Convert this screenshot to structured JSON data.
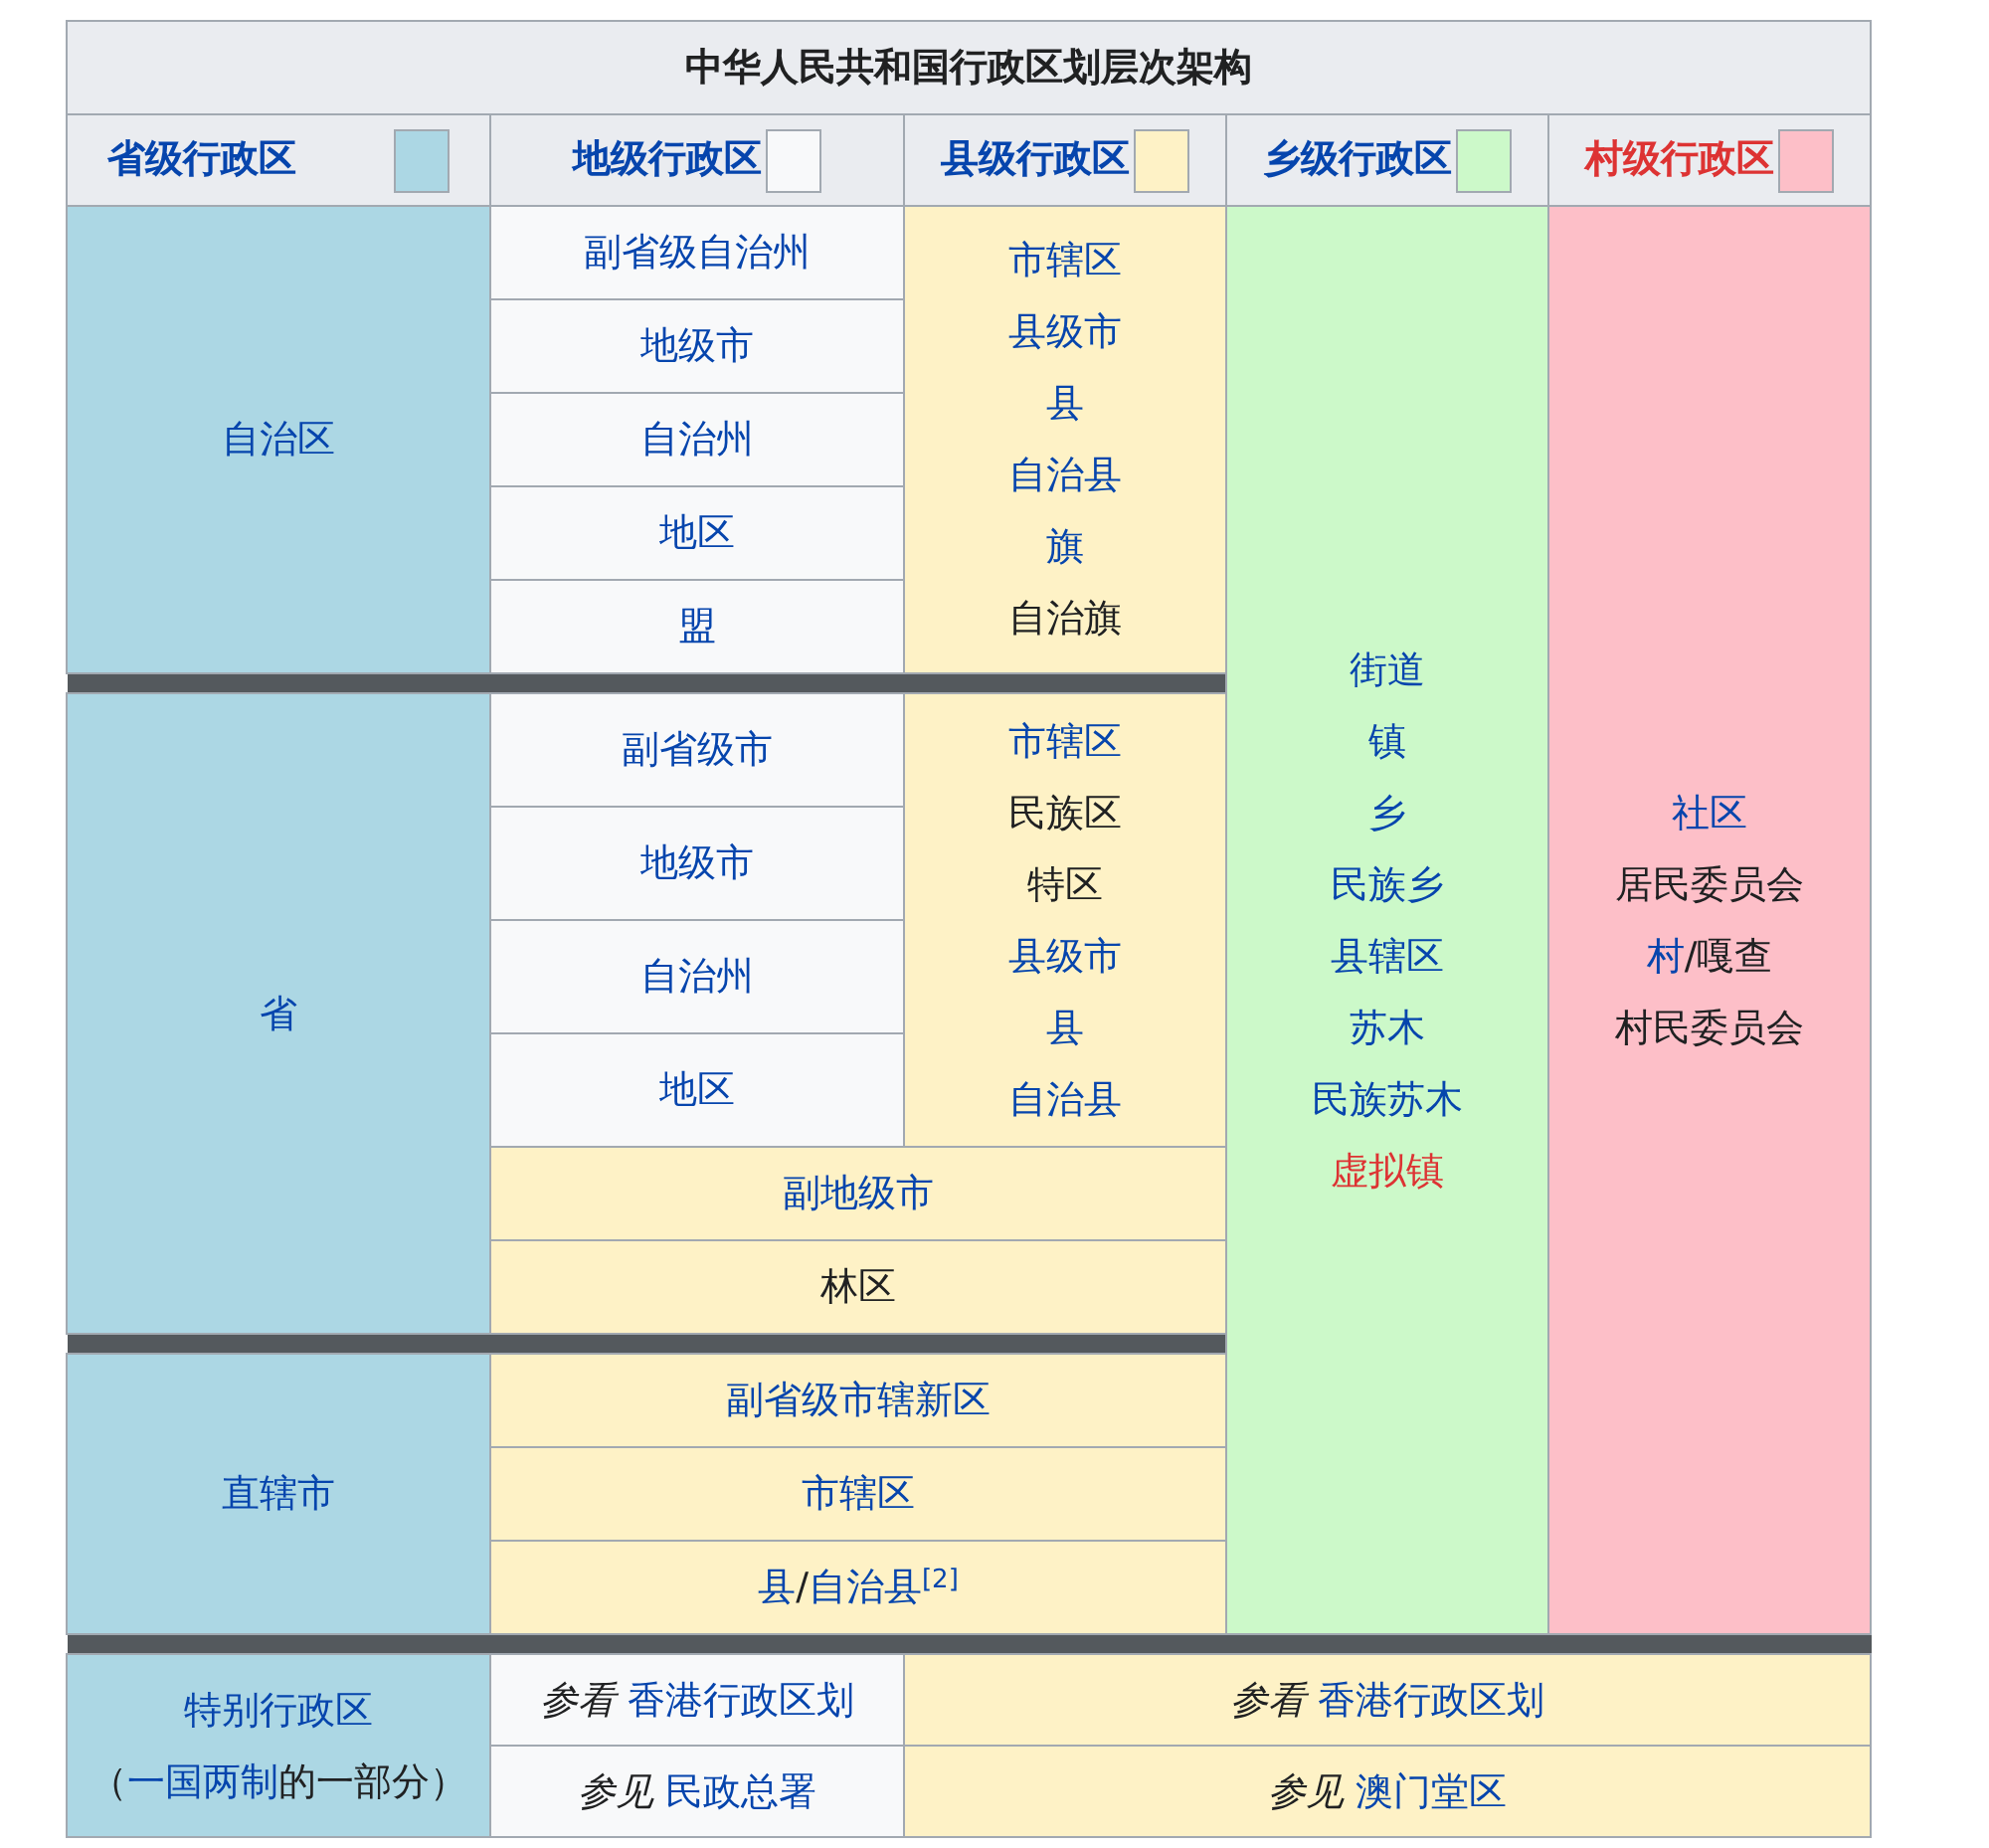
{
  "title": "中华人民共和国行政区划层次架构",
  "levels": [
    {
      "label": "省级行政区",
      "kind": "link",
      "color": "#acd7e4"
    },
    {
      "label": "地级行政区",
      "kind": "link",
      "color": "#f8f9fa"
    },
    {
      "label": "县级行政区",
      "kind": "link",
      "color": "#fef2c6"
    },
    {
      "label": "乡级行政区",
      "kind": "link",
      "color": "#ccf9c9"
    },
    {
      "label": "村级行政区",
      "kind": "new_link",
      "color": "#fdbfc8"
    }
  ],
  "sections": [
    {
      "province": [
        [
          {
            "kind": "link",
            "text": "自治区"
          }
        ]
      ],
      "prefecture": [
        [
          {
            "kind": "link",
            "text": "副省级自治州"
          }
        ],
        [
          {
            "kind": "link",
            "text": "地级市"
          }
        ],
        [
          {
            "kind": "link",
            "text": "自治州"
          }
        ],
        [
          {
            "kind": "link",
            "text": "地区"
          }
        ],
        [
          {
            "kind": "link",
            "text": "盟"
          }
        ]
      ],
      "county": [
        [
          {
            "kind": "link",
            "text": "市辖区"
          }
        ],
        [
          {
            "kind": "link",
            "text": "县级市"
          }
        ],
        [
          {
            "kind": "link",
            "text": "县"
          }
        ],
        [
          {
            "kind": "link",
            "text": "自治县"
          }
        ],
        [
          {
            "kind": "link",
            "text": "旗"
          }
        ],
        [
          {
            "kind": "plain",
            "text": "自治旗"
          }
        ]
      ]
    },
    {
      "province": [
        [
          {
            "kind": "link",
            "text": "省"
          }
        ]
      ],
      "prefecture": [
        [
          {
            "kind": "link",
            "text": "副省级市"
          }
        ],
        [
          {
            "kind": "link",
            "text": "地级市"
          }
        ],
        [
          {
            "kind": "link",
            "text": "自治州"
          }
        ],
        [
          {
            "kind": "link",
            "text": "地区"
          }
        ]
      ],
      "county": [
        [
          {
            "kind": "link",
            "text": "市辖区"
          }
        ],
        [
          {
            "kind": "plain",
            "text": "民族区"
          }
        ],
        [
          {
            "kind": "plain",
            "text": "特区"
          }
        ],
        [
          {
            "kind": "link",
            "text": "县级市"
          }
        ],
        [
          {
            "kind": "link",
            "text": "县"
          }
        ],
        [
          {
            "kind": "link",
            "text": "自治县"
          }
        ]
      ],
      "merged_rows": [
        [
          {
            "kind": "link",
            "text": "副地级市"
          }
        ],
        [
          {
            "kind": "plain",
            "text": "林区"
          }
        ]
      ]
    },
    {
      "province": [
        [
          {
            "kind": "link",
            "text": "直辖市"
          }
        ]
      ],
      "merged_rows": [
        [
          {
            "kind": "link",
            "text": "副省级市辖新区"
          }
        ],
        [
          {
            "kind": "link",
            "text": "市辖区"
          }
        ],
        [
          {
            "kind": "link",
            "text": "县"
          },
          {
            "kind": "plain",
            "text": "/"
          },
          {
            "kind": "link",
            "text": "自治县"
          },
          {
            "kind": "ref",
            "text": "[2]"
          }
        ]
      ]
    }
  ],
  "township": [
    [
      {
        "kind": "link",
        "text": "街道"
      }
    ],
    [
      {
        "kind": "link",
        "text": "镇"
      }
    ],
    [
      {
        "kind": "link",
        "text": "乡"
      }
    ],
    [
      {
        "kind": "link",
        "text": "民族乡"
      }
    ],
    [
      {
        "kind": "link",
        "text": "县辖区"
      }
    ],
    [
      {
        "kind": "link",
        "text": "苏木"
      }
    ],
    [
      {
        "kind": "link",
        "text": "民族苏木"
      }
    ],
    [
      {
        "kind": "new_link",
        "text": "虚拟镇"
      }
    ]
  ],
  "village": [
    [
      {
        "kind": "link",
        "text": "社区"
      }
    ],
    [
      {
        "kind": "plain",
        "text": "居民委员会"
      }
    ],
    [
      {
        "kind": "link",
        "text": "村"
      },
      {
        "kind": "plain",
        "text": "/嘎查"
      }
    ],
    [
      {
        "kind": "plain",
        "text": "村民委员会"
      }
    ]
  ],
  "special": {
    "province": [
      [
        {
          "kind": "link",
          "text": "特别行政区"
        }
      ],
      [
        {
          "kind": "plain",
          "text": "（"
        },
        {
          "kind": "link",
          "text": "一国两制"
        },
        {
          "kind": "plain",
          "text": "的一部分）"
        }
      ]
    ],
    "rows": [
      {
        "left": [
          {
            "kind": "note",
            "text": "参看 "
          },
          {
            "kind": "link",
            "text": "香港行政区划"
          }
        ],
        "right": [
          {
            "kind": "note",
            "text": "参看 "
          },
          {
            "kind": "link",
            "text": "香港行政区划"
          }
        ]
      },
      {
        "left": [
          {
            "kind": "note",
            "text": "参见 "
          },
          {
            "kind": "link",
            "text": "民政总署"
          }
        ],
        "right": [
          {
            "kind": "note",
            "text": "参见 "
          },
          {
            "kind": "link",
            "text": "澳门堂区"
          }
        ]
      }
    ]
  }
}
